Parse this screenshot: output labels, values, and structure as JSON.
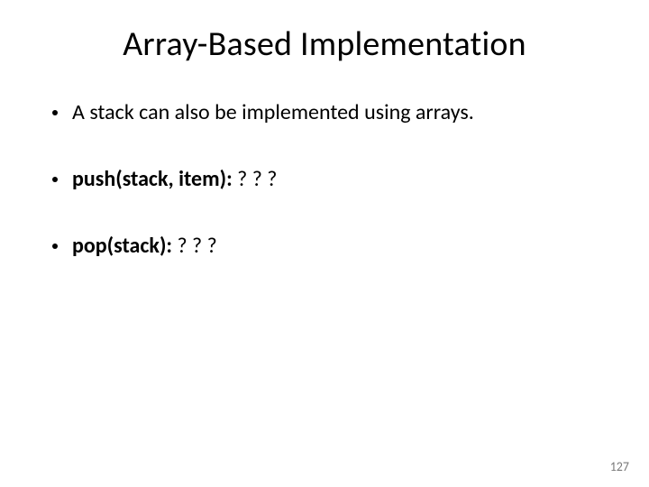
{
  "slide": {
    "title": "Array-Based Implementation",
    "bullets": [
      {
        "bold": "",
        "plain": "A stack can also be implemented using arrays."
      },
      {
        "bold": "push(stack, item): ",
        "plain": "? ? ?"
      },
      {
        "bold": "pop(stack): ",
        "plain": "? ? ?"
      }
    ],
    "page_number": "127"
  }
}
